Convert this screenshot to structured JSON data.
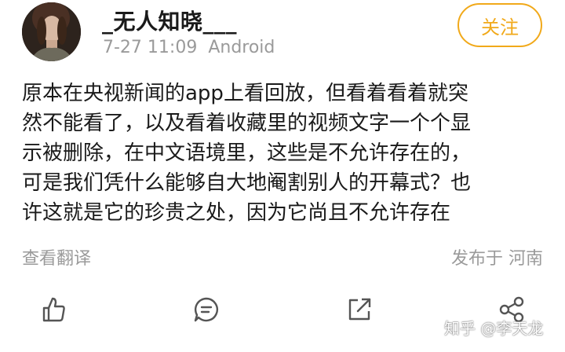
{
  "post": {
    "username": "_无人知晓___",
    "timestamp": "7-27 11:09",
    "device": "Android",
    "follow_label": "关注",
    "lines": [
      "原本在央视新闻的app上看回放，但看着看着就突",
      "然不能看了，以及看着收藏里的视频文字一个个显",
      "示被删除，在中文语境里，这些是不允许存在的，",
      "可是我们凭什么能够自大地阉割别人的开幕式？也",
      "许这就是它的珍贵之处，因为它尚且不允许存在"
    ],
    "translate_label": "查看翻译",
    "location_label": "发布于 河南"
  },
  "actions": {
    "like_icon": "thumbs-up-icon",
    "comment_icon": "comment-icon",
    "repost_icon": "external-share-icon",
    "share_icon": "share-nodes-icon"
  },
  "watermark": "知乎 @李天龙",
  "colors": {
    "accent": "#f1a91a",
    "text": "#1a1a1a",
    "muted": "#9a9a9a"
  }
}
